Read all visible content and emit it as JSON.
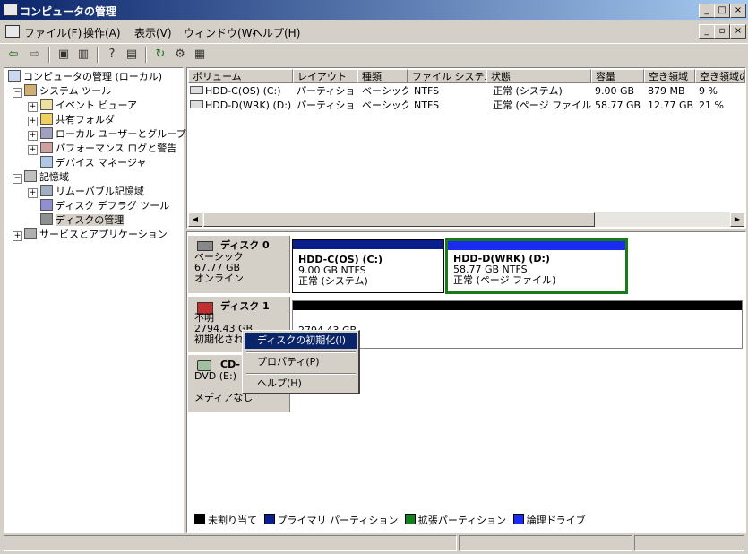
{
  "window": {
    "title": "コンピュータの管理",
    "caption_buttons": [
      "_",
      "□",
      "×"
    ]
  },
  "menu": [
    "ファイル(F)",
    "操作(A)",
    "表示(V)",
    "ウィンドウ(W)",
    "ヘルプ(H)"
  ],
  "toolbar_icons": [
    "back-icon",
    "forward-icon",
    "up-folder-icon",
    "show-tree-icon",
    "help-icon",
    "properties-icon",
    "refresh-icon",
    "settings-icon",
    "disk-icon"
  ],
  "tree": [
    {
      "label": "コンピュータの管理 (ローカル)",
      "icon": "computer-icon"
    },
    {
      "label": "システム ツール",
      "icon": "tools-icon"
    },
    {
      "label": "イベント ビューア",
      "icon": "event-viewer-icon"
    },
    {
      "label": "共有フォルダ",
      "icon": "shared-folder-icon"
    },
    {
      "label": "ローカル ユーザーとグループ",
      "icon": "users-icon"
    },
    {
      "label": "パフォーマンス ログと警告",
      "icon": "performance-icon"
    },
    {
      "label": "デバイス マネージャ",
      "icon": "device-manager-icon"
    },
    {
      "label": "記憶域",
      "icon": "storage-icon"
    },
    {
      "label": "リムーバブル記憶域",
      "icon": "removable-storage-icon"
    },
    {
      "label": "ディスク デフラグ ツール",
      "icon": "defrag-icon"
    },
    {
      "label": "ディスクの管理",
      "icon": "disk-management-icon"
    },
    {
      "label": "サービスとアプリケーション",
      "icon": "services-icon"
    }
  ],
  "volume_list": {
    "headers": [
      "ボリューム",
      "レイアウト",
      "種類",
      "ファイル システム",
      "状態",
      "容量",
      "空き領域",
      "空き領域の"
    ],
    "rows": [
      [
        "HDD-C(OS) (C:)",
        "パーティション",
        "ベーシック",
        "NTFS",
        "正常 (システム)",
        "9.00 GB",
        "879 MB",
        "9 %"
      ],
      [
        "HDD-D(WRK) (D:)",
        "パーティション",
        "ベーシック",
        "NTFS",
        "正常 (ページ ファイル)",
        "58.77 GB",
        "12.77 GB",
        "21 %"
      ]
    ]
  },
  "disks": [
    {
      "label": {
        "name": "ディスク 0",
        "type": "ベーシック",
        "size": "67.77 GB",
        "status": "オンライン"
      },
      "volumes": [
        {
          "name": "HDD-C(OS)  (C:)",
          "size_fs": "9.00 GB NTFS",
          "status": "正常 (システム)",
          "bar_color": "#0a1e8c"
        },
        {
          "name": "HDD-D(WRK)  (D:)",
          "size_fs": "58.77 GB NTFS",
          "status": "正常 (ページ ファイル)",
          "bar_color": "#1a2cf0"
        }
      ]
    },
    {
      "label": {
        "name": "ディスク 1",
        "type": "不明",
        "size": "2794.43 GB",
        "status": "初期化され"
      },
      "volumes": [
        {
          "size": "2794.43 GB",
          "bar_color": "#000000"
        }
      ]
    },
    {
      "label": {
        "name": "CD-",
        "type": "DVD (E:)",
        "status": "メディアなし"
      }
    }
  ],
  "context_menu": {
    "items": [
      "ディスクの初期化(I)",
      "プロパティ(P)",
      "ヘルプ(H)"
    ]
  },
  "legend": [
    {
      "label": "未割り当て",
      "color": "#000000"
    },
    {
      "label": "プライマリ パーティション",
      "color": "#0a1e8c"
    },
    {
      "label": "拡張パーティション",
      "color": "#108020"
    },
    {
      "label": "論理ドライブ",
      "color": "#1a2cf0"
    }
  ]
}
